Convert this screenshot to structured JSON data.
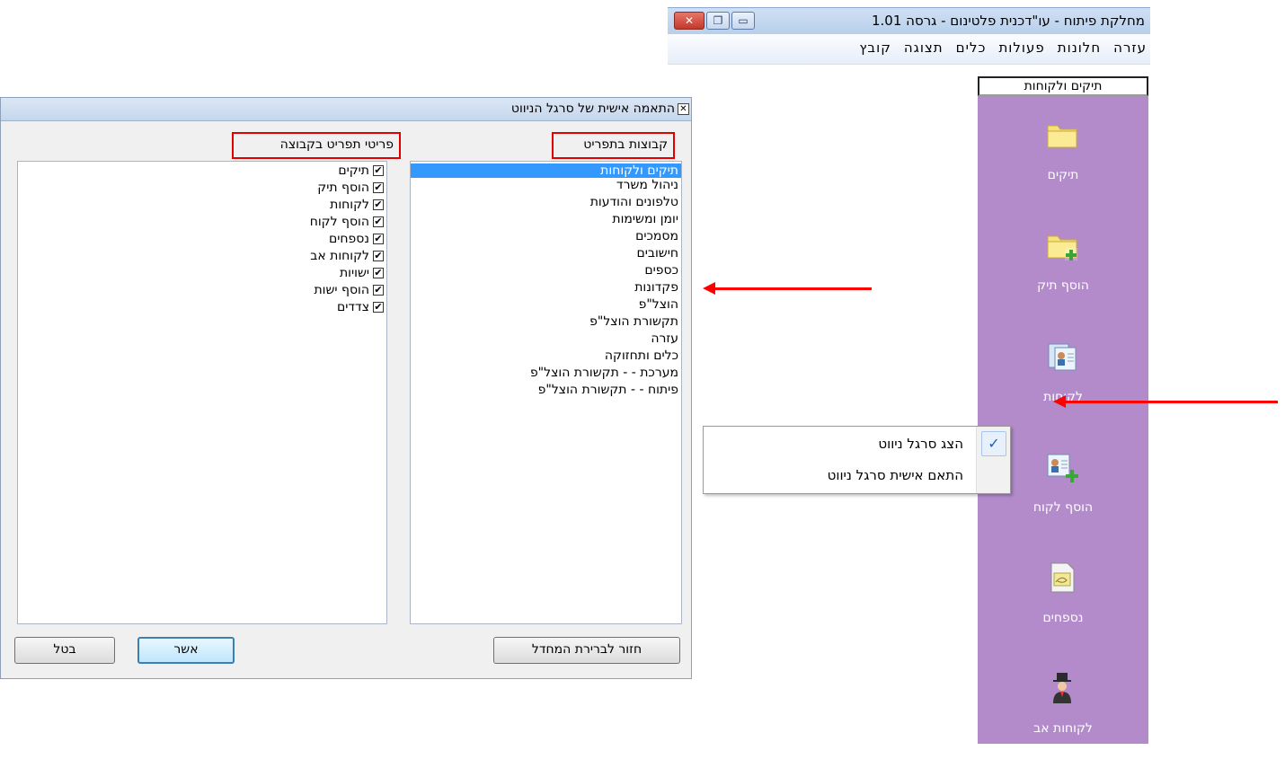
{
  "app": {
    "title": "מחלקת פיתוח - עו\"דכנית פלטינום - גרסה 1.01",
    "window_controls": {
      "close": "✕",
      "maximize": "❐",
      "minimize": "▭"
    },
    "menu": [
      "קובץ",
      "תצוגה",
      "כלים",
      "פעולות",
      "חלונות",
      "עזרה"
    ]
  },
  "nav_pane": {
    "header": "תיקים ולקוחות",
    "items": [
      {
        "label": "תיקים",
        "icon": "folder-icon"
      },
      {
        "label": "הוסף תיק",
        "icon": "add-folder-icon"
      },
      {
        "label": "לקוחות",
        "icon": "clients-cards-icon"
      },
      {
        "label": "הוסף לקוח",
        "icon": "add-client-icon"
      },
      {
        "label": "נספחים",
        "icon": "attachment-icon"
      },
      {
        "label": "לקוחות אב",
        "icon": "top-hat-person-icon"
      }
    ],
    "background": "#b38bcb"
  },
  "context_menu": {
    "items": [
      {
        "label": "הצג סרגל ניווט",
        "checked": true
      },
      {
        "label": "התאם אישית סרגל ניווט",
        "checked": false
      }
    ],
    "check_glyph": "✓"
  },
  "dialog": {
    "title": "התאמה אישית של סרגל הניווט",
    "close_glyph": "✕",
    "groups_label": "קבוצות בתפריט",
    "items_label": "פריטי תפריט בקבוצה",
    "groups": [
      "תיקים ולקוחות",
      "ניהול משרד",
      "טלפונים והודעות",
      "יומן ומשימות",
      "מסמכים",
      "חישובים",
      "כספים",
      "פקדונות",
      "הוצל\"פ",
      "תקשורת הוצל\"פ",
      "עזרה",
      "כלים ותחזוקה",
      "מערכת - - תקשורת הוצל\"פ",
      "פיתוח - - תקשורת הוצל\"פ"
    ],
    "selected_group_index": 0,
    "items": [
      {
        "label": "תיקים",
        "checked": true
      },
      {
        "label": "הוסף תיק",
        "checked": true
      },
      {
        "label": "לקוחות",
        "checked": true
      },
      {
        "label": "הוסף לקוח",
        "checked": true
      },
      {
        "label": "נספחים",
        "checked": true
      },
      {
        "label": "לקוחות אב",
        "checked": true
      },
      {
        "label": "ישויות",
        "checked": true
      },
      {
        "label": "הוסף ישות",
        "checked": true
      },
      {
        "label": "צדדים",
        "checked": true
      }
    ],
    "check_glyph": "✔",
    "buttons": {
      "reset": "חזור לברירת המחדל",
      "ok": "אשר",
      "cancel": "בטל"
    }
  },
  "annotation_color": "#ff0000"
}
